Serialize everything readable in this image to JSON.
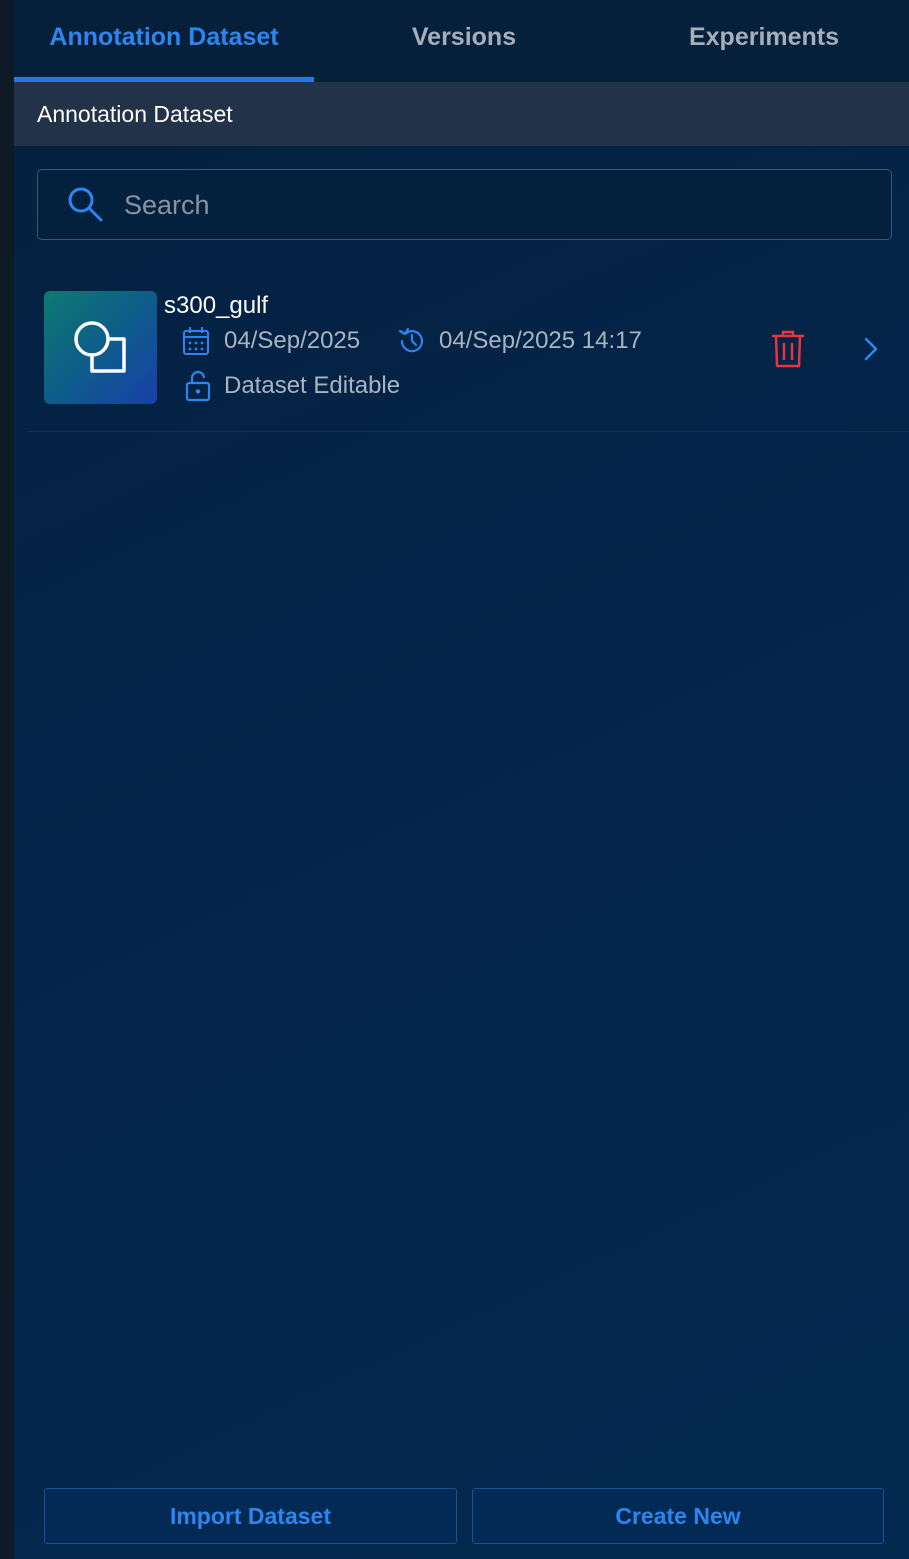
{
  "tabs": [
    {
      "label": "Annotation Dataset",
      "active": true
    },
    {
      "label": "Versions",
      "active": false
    },
    {
      "label": "Experiments",
      "active": false
    }
  ],
  "section": {
    "title": "Annotation Dataset"
  },
  "search": {
    "placeholder": "Search",
    "value": ""
  },
  "datasets": [
    {
      "name": "s300_gulf",
      "created": "04/Sep/2025",
      "modified": "04/Sep/2025 14:17",
      "status": "Dataset Editable",
      "icons": [
        "calendar-icon",
        "history-icon",
        "unlock-icon",
        "delete-icon",
        "chevron-right-icon"
      ]
    }
  ],
  "footer": {
    "import_label": "Import Dataset",
    "create_label": "Create New"
  },
  "colors": {
    "accent": "#2d86f0",
    "danger": "#e5363a",
    "header_bg": "#223248"
  }
}
